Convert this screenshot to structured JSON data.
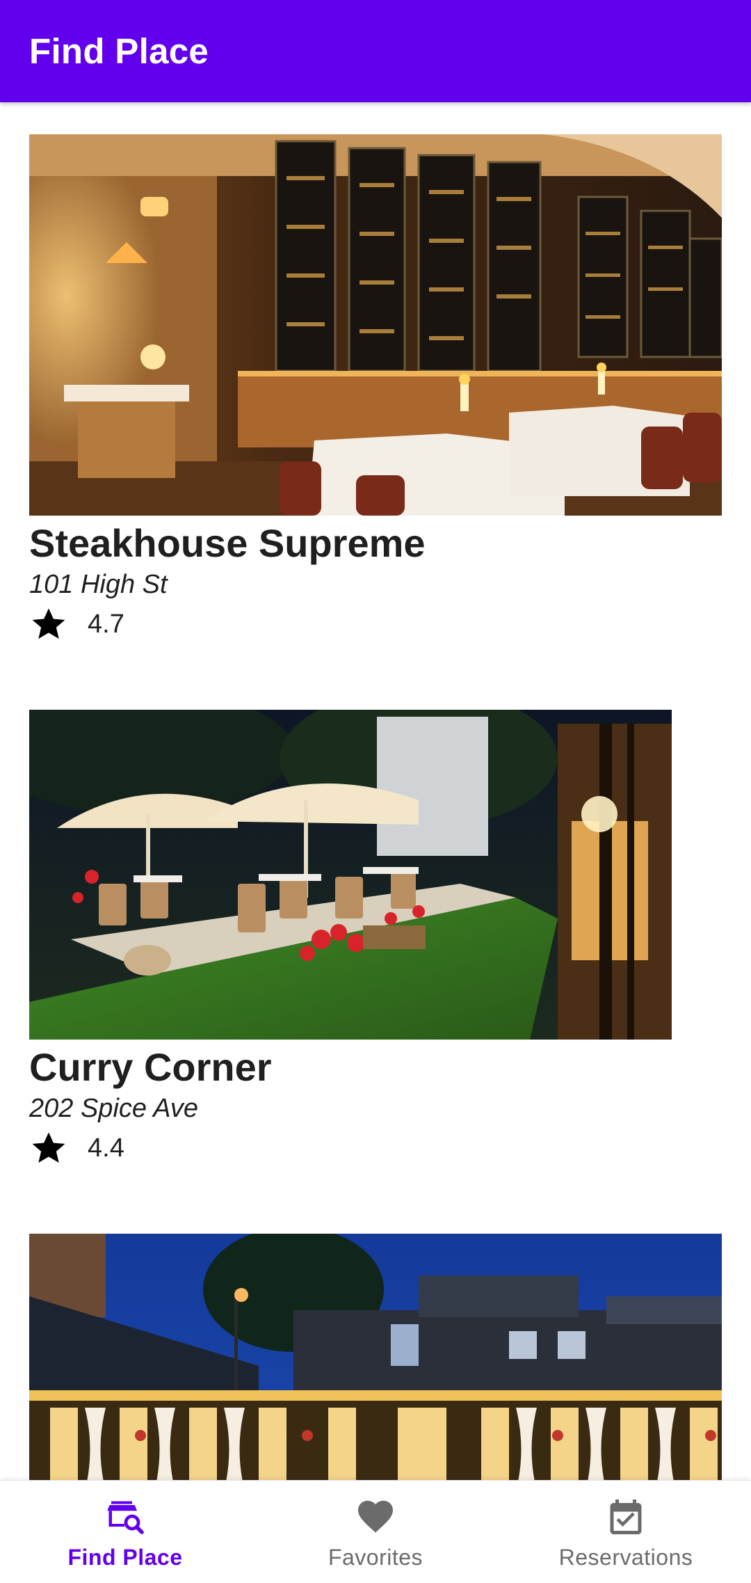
{
  "app_bar": {
    "title": "Find Place",
    "color": "#6200ee"
  },
  "places": [
    {
      "name": "Steakhouse Supreme",
      "address": "101 High St",
      "rating": "4.7",
      "rating_icon": "star-icon"
    },
    {
      "name": "Curry Corner",
      "address": "202 Spice Ave",
      "rating": "4.4",
      "rating_icon": "star-icon"
    },
    {
      "name": "",
      "address": "",
      "rating": "",
      "rating_icon": "star-icon"
    }
  ],
  "bottom_nav": {
    "active_color": "#6200ee",
    "items": [
      {
        "label": "Find Place",
        "icon": "search-place-icon",
        "active": true
      },
      {
        "label": "Favorites",
        "icon": "heart-icon",
        "active": false
      },
      {
        "label": "Reservations",
        "icon": "calendar-check-icon",
        "active": false
      }
    ]
  }
}
